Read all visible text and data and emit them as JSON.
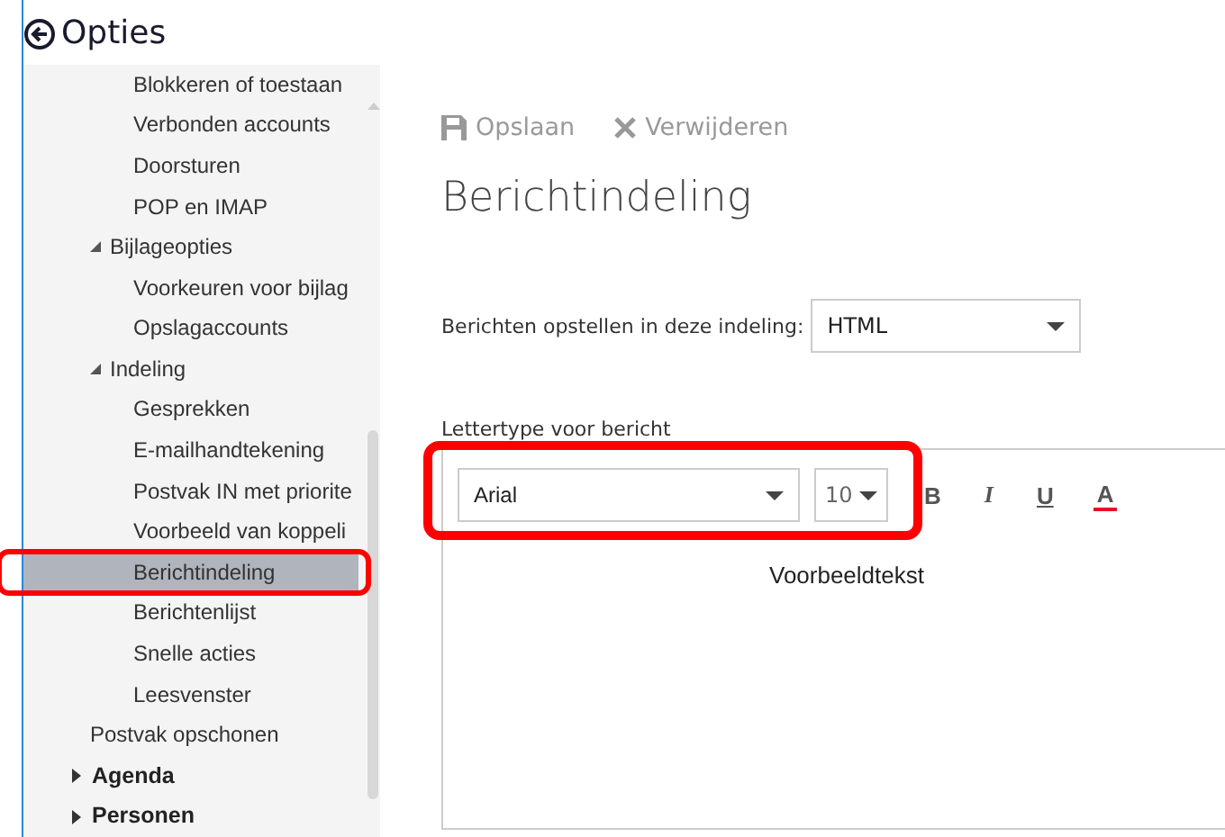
{
  "header": {
    "title": "Opties"
  },
  "sidebar": {
    "continued_items": [
      {
        "label": "Blokkeren of toestaan",
        "selected": false
      },
      {
        "label": "Verbonden accounts",
        "selected": false
      },
      {
        "label": "Doorsturen",
        "selected": false
      },
      {
        "label": "POP en IMAP",
        "selected": false
      }
    ],
    "sections": [
      {
        "label": "Bijlageopties",
        "expanded": true,
        "selected": false,
        "children": [
          {
            "label": "Voorkeuren voor bijlag",
            "selected": false
          },
          {
            "label": "Opslagaccounts",
            "selected": false
          }
        ]
      },
      {
        "label": "Indeling",
        "expanded": true,
        "selected": false,
        "children": [
          {
            "label": "Gesprekken",
            "selected": false
          },
          {
            "label": "E-mailhandtekening",
            "selected": false
          },
          {
            "label": "Postvak IN met priorite",
            "selected": false
          },
          {
            "label": "Voorbeeld van koppeli",
            "selected": false
          },
          {
            "label": "Berichtindeling",
            "selected": true
          },
          {
            "label": "Berichtenlijst",
            "selected": false
          },
          {
            "label": "Snelle acties",
            "selected": false
          },
          {
            "label": "Leesvenster",
            "selected": false
          }
        ]
      },
      {
        "label": "Postvak opschonen",
        "selected": false
      }
    ],
    "top_items": [
      {
        "label": "Agenda",
        "expanded": false
      },
      {
        "label": "Personen",
        "expanded": false
      }
    ]
  },
  "toolbar": [
    {
      "kind": "save",
      "label": "Opslaan",
      "disabled": true
    },
    {
      "kind": "delete",
      "label": "Verwijderen",
      "disabled": true
    }
  ],
  "page_title": "Berichtindeling",
  "format_field": {
    "label": "Berichten opstellen in deze indeling:",
    "value": "HTML"
  },
  "font_section": {
    "label": "Lettertype voor bericht",
    "font": "Arial",
    "size": "10",
    "format_buttons": [
      {
        "kind": "bold",
        "label": "B"
      },
      {
        "kind": "italic",
        "label": "I"
      },
      {
        "kind": "underline",
        "label": "U"
      },
      {
        "kind": "color",
        "label": "A"
      }
    ],
    "sample_text": "Voorbeeldtekst"
  }
}
